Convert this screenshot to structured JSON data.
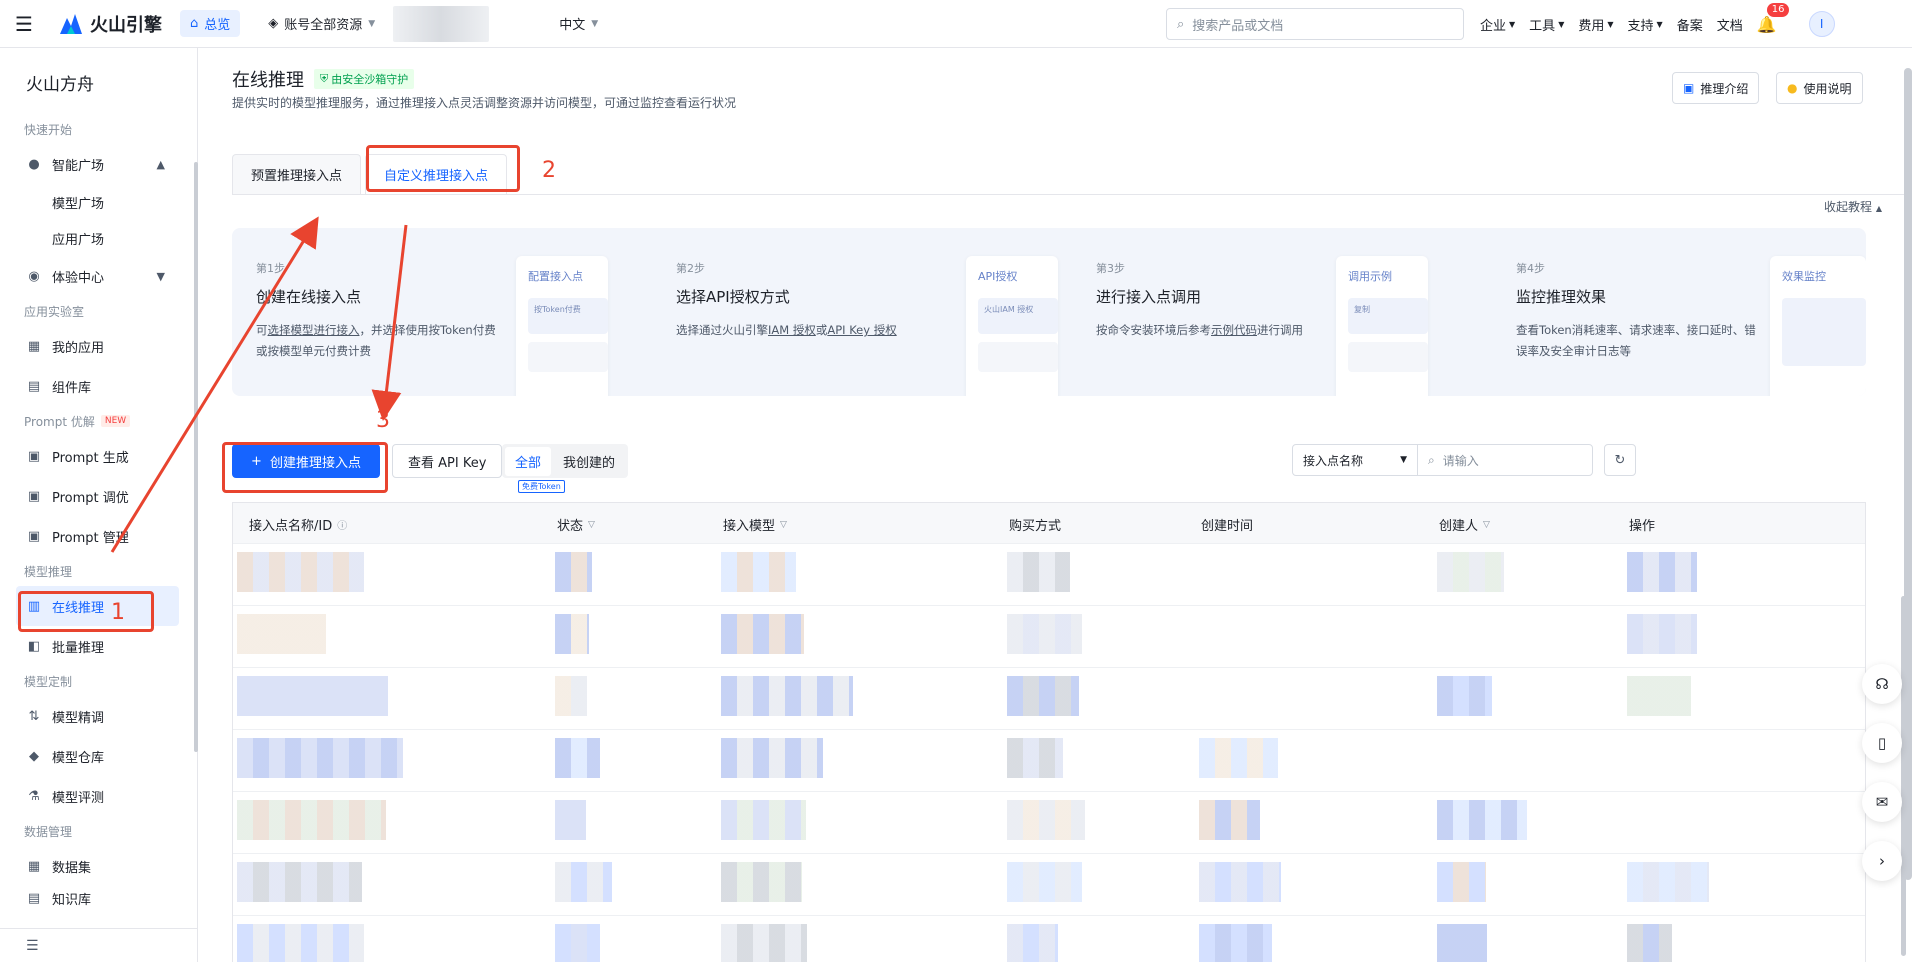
{
  "topbar": {
    "logo": "火山引擎",
    "home": "总览",
    "account": "账号全部资源",
    "lang": "中文",
    "search_placeholder": "搜索产品或文档",
    "menus": [
      "企业",
      "工具",
      "费用",
      "支持"
    ],
    "links": [
      "备案",
      "文档"
    ],
    "notification_count": "16",
    "avatar": "I"
  },
  "sidebar": {
    "title": "火山方舟",
    "quick_start": "快速开始",
    "smart_plaza": "智能广场",
    "model_plaza": "模型广场",
    "app_plaza": "应用广场",
    "experience": "体验中心",
    "app_lab": "应用实验室",
    "my_apps": "我的应用",
    "components": "组件库",
    "prompt_opt": "Prompt 优解",
    "new_badge": "NEW",
    "prompt_gen": "Prompt 生成",
    "prompt_tune": "Prompt 调优",
    "prompt_mgmt": "Prompt 管理",
    "model_infer": "模型推理",
    "online_infer": "在线推理",
    "batch_infer": "批量推理",
    "model_custom": "模型定制",
    "fine_tune": "模型精调",
    "model_repo": "模型仓库",
    "model_eval": "模型评测",
    "data_mgmt": "数据管理",
    "dataset": "数据集",
    "knowledge": "知识库"
  },
  "page": {
    "title": "在线推理",
    "sandbox": "由安全沙箱守护",
    "desc": "提供实时的模型推理服务，通过推理接入点灵活调整资源并访问模型，可通过监控查看运行状况",
    "btn_intro": "推理介绍",
    "btn_usage": "使用说明",
    "tab_preset": "预置推理接入点",
    "tab_custom": "自定义推理接入点",
    "collapse": "收起教程"
  },
  "steps": [
    {
      "no": "第1步",
      "title": "创建在线接入点",
      "desc_a": "可",
      "link1": "选择模型进行接入",
      "desc_b": "，并选择使用按Token付费或按模型单元付费计费",
      "card": "配置接入点",
      "mock": "按Token付费"
    },
    {
      "no": "第2步",
      "title": "选择API授权方式",
      "desc_a": "选择通过火山引擎",
      "link1": "IAM 授权",
      "desc_b": "或",
      "link2": "API Key 授权",
      "card": "API授权",
      "mock": "火山IAM 授权"
    },
    {
      "no": "第3步",
      "title": "进行接入点调用",
      "desc_a": "按命令安装环境后参考",
      "link1": "示例代码",
      "desc_b": "进行调用",
      "card": "调用示例",
      "mock": "复制"
    },
    {
      "no": "第4步",
      "title": "监控推理效果",
      "desc_a": "查看Token消耗速率、请求速率、接口延时、错误率及安全审计日志等",
      "card": "效果监控",
      "mock": ""
    }
  ],
  "toolbar": {
    "create": "创建推理接入点",
    "view_key": "查看 API Key",
    "seg_all": "全部",
    "seg_mine": "我创建的",
    "filter_field": "接入点名称",
    "filter_placeholder": "请输入",
    "token_tag": "免费Token"
  },
  "table": {
    "headers": [
      "接入点名称/ID",
      "状态",
      "接入模型",
      "购买方式",
      "创建时间",
      "创建人",
      "操作"
    ]
  },
  "annotations": [
    "1",
    "2",
    "3"
  ],
  "colors": {
    "accent": "#1664ff",
    "annotation": "#e8442f"
  }
}
